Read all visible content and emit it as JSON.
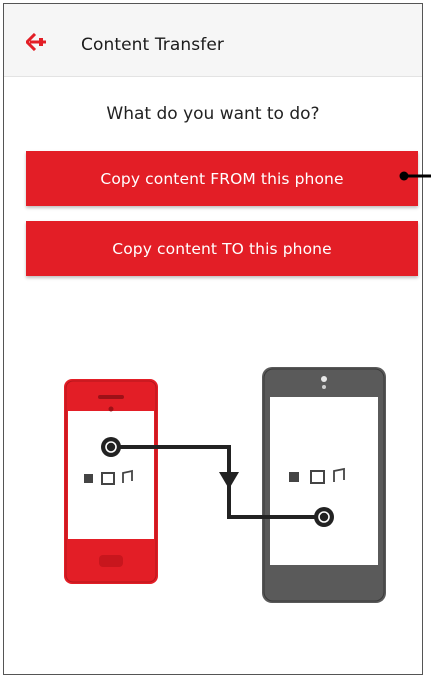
{
  "app": {
    "title": "Content Transfer",
    "back_icon": "arrow-left-icon",
    "accent_color": "#e31e26"
  },
  "main": {
    "question": "What do you want to do?",
    "buttons": {
      "copy_from_label": "Copy content FROM this phone",
      "copy_to_label": "Copy content TO this phone"
    }
  },
  "illustration": {
    "source_phone_icon": "red-phone-icon",
    "target_phone_icon": "dark-phone-icon",
    "transfer_icon": "transfer-arrow-icon",
    "content_icons": [
      "contacts-icon",
      "calendar-icon",
      "music-icon"
    ]
  }
}
